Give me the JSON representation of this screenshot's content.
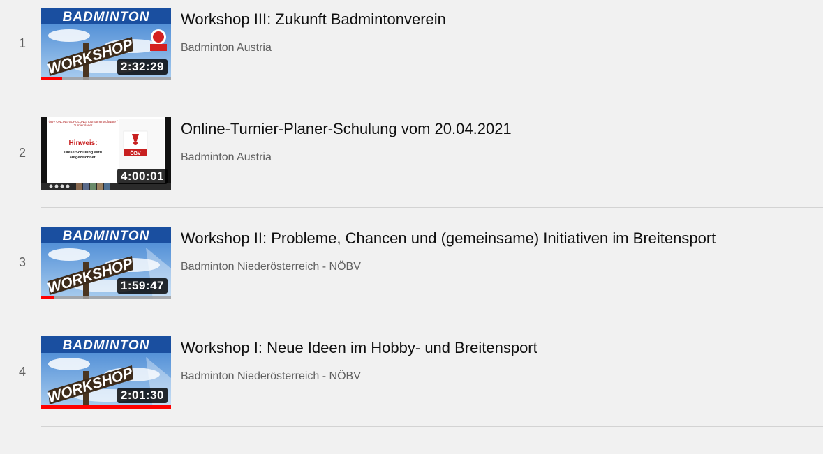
{
  "playlist": {
    "items": [
      {
        "index": "1",
        "title": "Workshop III: Zukunft Badmintonverein",
        "channel": "Badminton Austria",
        "duration": "2:32:29",
        "progress": 0.16,
        "thumbnail": "badminton-workshop"
      },
      {
        "index": "2",
        "title": "Online-Turnier-Planer-Schulung vom 20.04.2021",
        "channel": "Badminton Austria",
        "duration": "4:00:01",
        "progress": 0,
        "thumbnail": "online-schulung-slide",
        "thumb_text": {
          "heading": "ÖBV ONLINE-SCHULUNG Tournamentsoftware / Turnierplaner",
          "hint_title": "Hinweis:",
          "hint_body": "Diese Schulung wird aufgezeichnet!",
          "logo": "ÖBV"
        }
      },
      {
        "index": "3",
        "title": "Workshop II: Probleme, Chancen und (gemeinsame) Initiativen im Breitensport",
        "channel": "Badminton Niederösterreich - NÖBV",
        "duration": "1:59:47",
        "progress": 0.1,
        "thumbnail": "badminton-workshop"
      },
      {
        "index": "4",
        "title": "Workshop I: Neue Ideen im Hobby- und Breitensport",
        "channel": "Badminton Niederösterreich - NÖBV",
        "duration": "2:01:30",
        "progress": 1.0,
        "thumbnail": "badminton-workshop"
      }
    ]
  },
  "thumbnail_text": {
    "banner": "BADMINTON",
    "sign": "WORKSHOP"
  },
  "colors": {
    "progress_red": "#ff0000",
    "sky_blue": "#6ba3d9",
    "banner_blue": "#1a4fa0",
    "background": "#f1f1f1"
  }
}
